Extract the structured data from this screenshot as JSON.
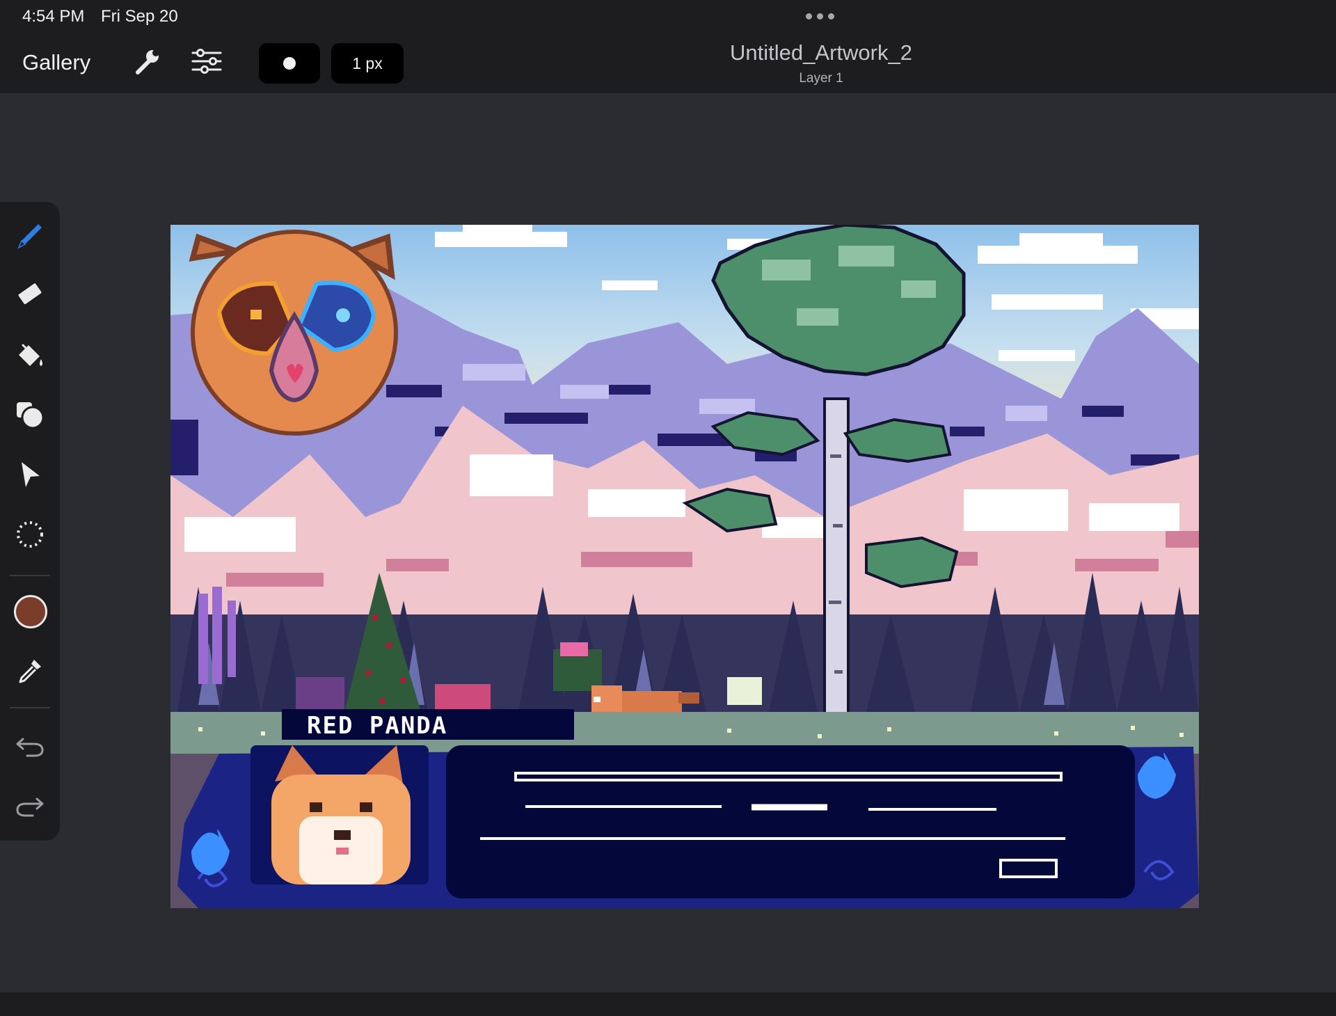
{
  "status_bar": {
    "time": "4:54 PM",
    "date": "Fri Sep 20"
  },
  "toolbar": {
    "gallery_label": "Gallery",
    "actions_icon": "wrench-icon",
    "adjustments_icon": "sliders-icon",
    "brush_size_label": "1 px"
  },
  "document": {
    "title": "Untitled_Artwork_2",
    "layer": "Layer 1"
  },
  "tools": [
    {
      "id": "brush",
      "icon": "brush-icon",
      "active": true
    },
    {
      "id": "eraser",
      "icon": "eraser-icon"
    },
    {
      "id": "fill",
      "icon": "fill-bucket-icon"
    },
    {
      "id": "layers",
      "icon": "shapes-icon"
    },
    {
      "id": "transform",
      "icon": "arrow-cursor-icon"
    },
    {
      "id": "selection",
      "icon": "lasso-select-icon"
    },
    {
      "id": "eyedropper",
      "icon": "eyedropper-icon"
    },
    {
      "id": "undo",
      "icon": "undo-icon"
    },
    {
      "id": "redo",
      "icon": "redo-icon"
    }
  ],
  "colors": {
    "current": "#7a3d2a",
    "accent": "#2d7ee0"
  },
  "artwork": {
    "nameplate_text": "RED PANDA",
    "sky_color": "#a6cbe8",
    "mountain_color": "#8c86cf",
    "dialog_color": "#04073a"
  }
}
